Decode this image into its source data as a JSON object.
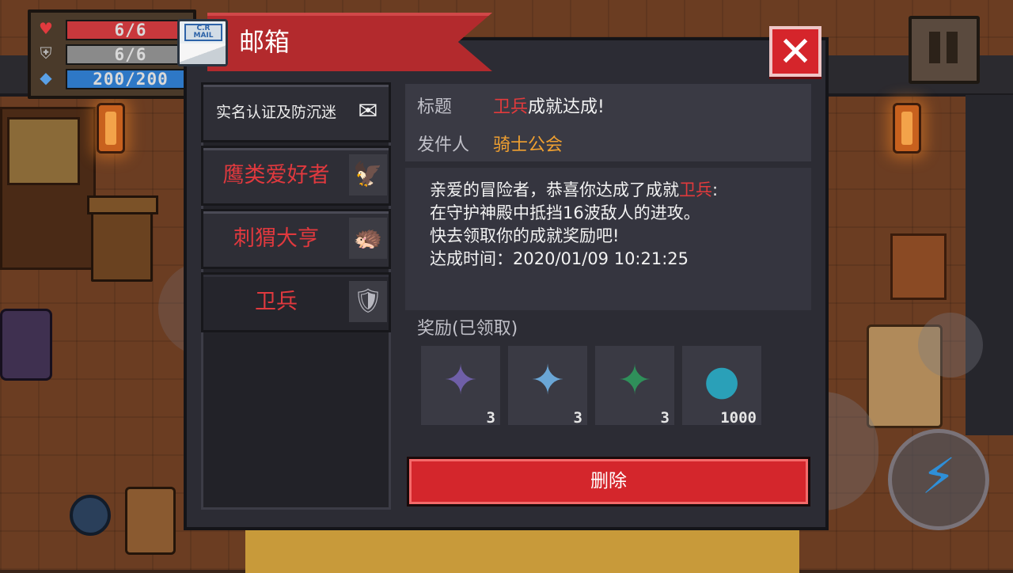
{
  "hud": {
    "health": {
      "text": "6/6",
      "fraction": 1.0,
      "color": "#c8383c"
    },
    "armor": {
      "text": "6/6",
      "fraction": 1.0,
      "color": "#8a8a8a"
    },
    "energy": {
      "text": "200/200",
      "fraction": 1.0,
      "color": "#2e78c6"
    },
    "health_icon": "heart-icon",
    "armor_icon": "shield-icon",
    "energy_icon": "diamond-icon",
    "pause_icon": "pause-icon",
    "skill_icon": "lightning-icon"
  },
  "mailbox": {
    "title": "邮箱",
    "title_icon": "mail-icon",
    "mail_icon_badge": "C.R MAIL",
    "close_icon": "close-icon",
    "mails": [
      {
        "label": "实名认证及防沉迷",
        "style": "plain",
        "thumb_icon": "envelope-icon",
        "thumb": "✉"
      },
      {
        "label": "鹰类爱好者",
        "style": "red",
        "thumb_icon": "eagle-icon",
        "thumb": "🦅"
      },
      {
        "label": "刺猬大亨",
        "style": "red",
        "thumb_icon": "hedgehog-icon",
        "thumb": "🦔"
      },
      {
        "label": "卫兵",
        "style": "red",
        "thumb_icon": "knight-helmet-icon",
        "thumb": "🛡",
        "selected": true
      }
    ],
    "detail": {
      "subject_key": "标题",
      "subject_highlight": "卫兵",
      "subject_rest": "成就达成!",
      "sender_key": "发件人",
      "sender": "骑士公会",
      "body_line1_pre": "亲爱的冒险者，恭喜你达成了成就",
      "body_line1_highlight": "卫兵",
      "body_line1_post": ":",
      "body_line2": "在守护神殿中抵挡16波敌人的进攻。",
      "body_line3": "快去领取你的成就奖励吧!",
      "body_line4": "达成时间：2020/01/09 10:21:25"
    },
    "rewards_label": "奖励(已领取)",
    "rewards": [
      {
        "icon": "purple-crystal-icon",
        "glyph": "✦",
        "color": "#6f5fa8",
        "qty": "3"
      },
      {
        "icon": "blue-crystal-icon",
        "glyph": "✦",
        "color": "#6aa6d6",
        "qty": "3"
      },
      {
        "icon": "green-crystal-icon",
        "glyph": "✦",
        "color": "#2f8f5a",
        "qty": "3"
      },
      {
        "icon": "blue-gem-coin-icon",
        "glyph": "●",
        "color": "#2aa0b8",
        "qty": "1000"
      }
    ],
    "delete_label": "删除"
  },
  "colors": {
    "accent_red": "#d4262c",
    "highlight_red": "#e23a3c",
    "sender_orange": "#f0a030"
  }
}
